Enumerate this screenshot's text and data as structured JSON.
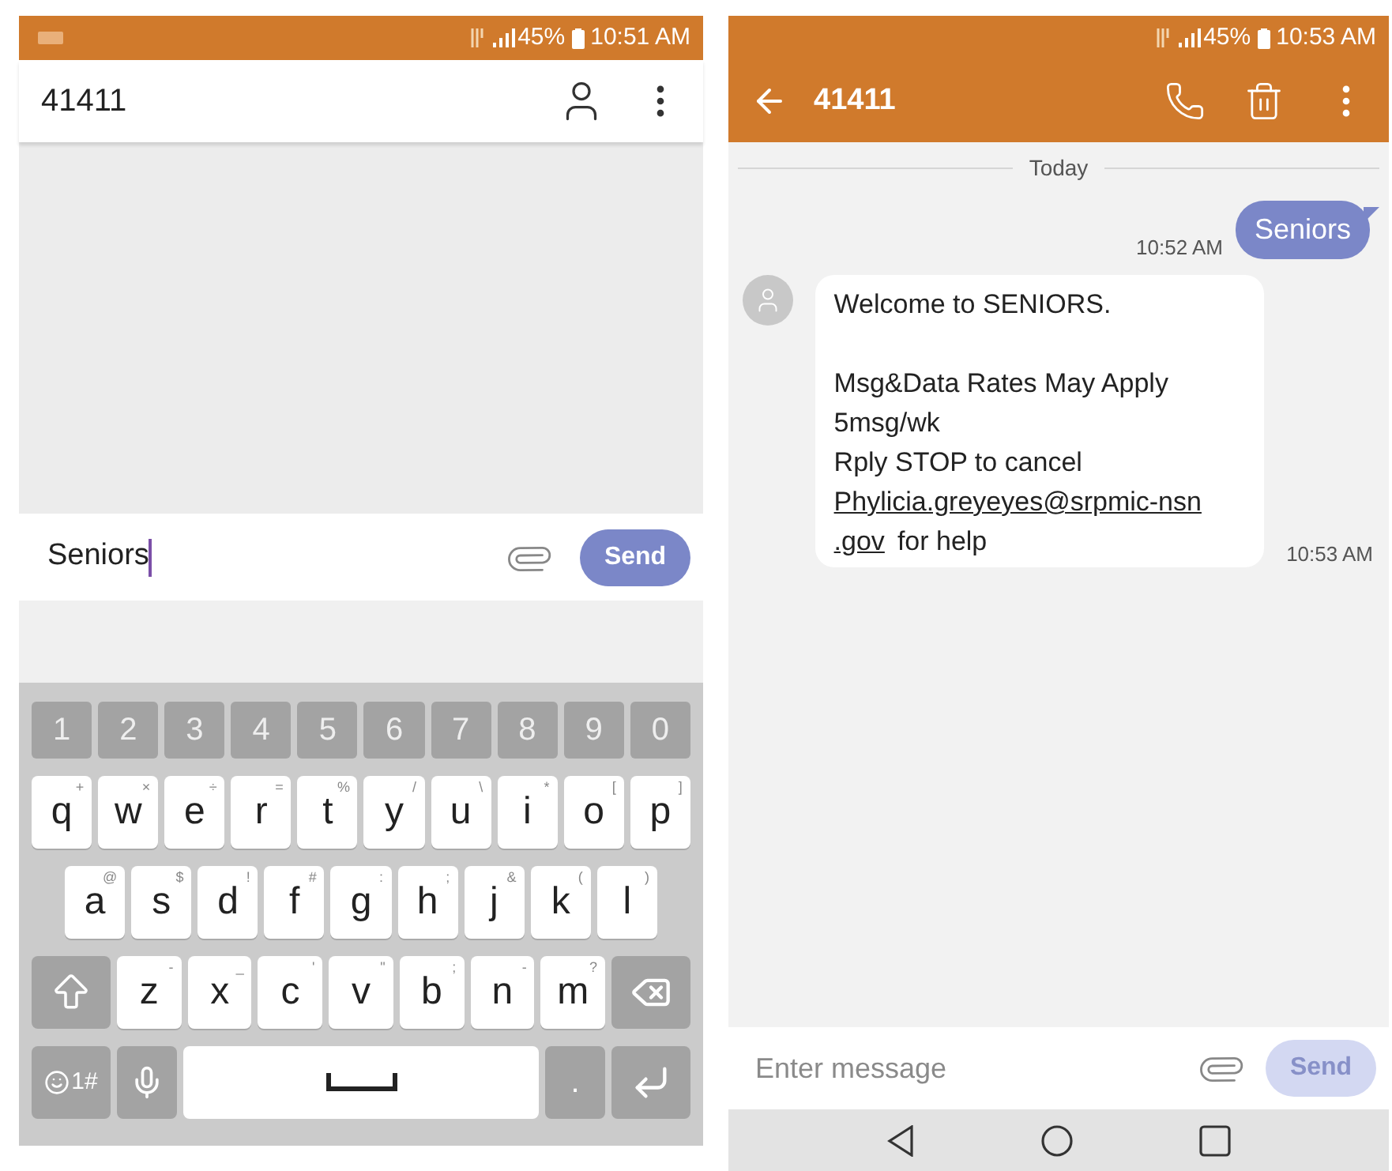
{
  "left_phone": {
    "status_bar": {
      "battery": "45%",
      "time": "10:51 AM"
    },
    "header": {
      "title": "41411"
    },
    "composer": {
      "value": "Seniors",
      "focused": true,
      "send_label": "Send",
      "send_disabled": false
    },
    "keyboard": {
      "number_row": [
        "1",
        "2",
        "3",
        "4",
        "5",
        "6",
        "7",
        "8",
        "9",
        "0"
      ],
      "letter_rows": [
        [
          {
            "key": "q",
            "hint": "+"
          },
          {
            "key": "w",
            "hint": "×"
          },
          {
            "key": "e",
            "hint": "÷"
          },
          {
            "key": "r",
            "hint": "="
          },
          {
            "key": "t",
            "hint": "%"
          },
          {
            "key": "y",
            "hint": "/"
          },
          {
            "key": "u",
            "hint": "\\"
          },
          {
            "key": "i",
            "hint": "*"
          },
          {
            "key": "o",
            "hint": "["
          },
          {
            "key": "p",
            "hint": "]"
          }
        ],
        [
          {
            "key": "a",
            "hint": "@"
          },
          {
            "key": "s",
            "hint": "$"
          },
          {
            "key": "d",
            "hint": "!"
          },
          {
            "key": "f",
            "hint": "#"
          },
          {
            "key": "g",
            "hint": ":"
          },
          {
            "key": "h",
            "hint": ";"
          },
          {
            "key": "j",
            "hint": "&"
          },
          {
            "key": "k",
            "hint": "("
          },
          {
            "key": "l",
            "hint": ")"
          }
        ],
        [
          {
            "key": "z",
            "hint": "-"
          },
          {
            "key": "x",
            "hint": "_"
          },
          {
            "key": "c",
            "hint": "'"
          },
          {
            "key": "v",
            "hint": "\""
          },
          {
            "key": "b",
            "hint": ";"
          },
          {
            "key": "n",
            "hint": "-"
          },
          {
            "key": "m",
            "hint": "?"
          }
        ]
      ],
      "symbols_key": "1#",
      "period_key": "."
    }
  },
  "right_phone": {
    "status_bar": {
      "battery": "45%",
      "time": "10:53 AM"
    },
    "header": {
      "title": "41411"
    },
    "date_divider": "Today",
    "messages": [
      {
        "kind": "sent",
        "text": "Seniors",
        "time": "10:52 AM"
      },
      {
        "kind": "received",
        "title": "Welcome to SENIORS.",
        "lines": [
          "Msg&Data Rates May Apply",
          "5msg/wk",
          "Rply STOP to cancel"
        ],
        "link_lines": [
          "Phylicia.greyeyes@srpmic-nsn",
          ".gov"
        ],
        "tail": "for help",
        "time": "10:53 AM"
      }
    ],
    "composer": {
      "placeholder": "Enter message",
      "focused": false,
      "send_label": "Send",
      "send_disabled": true
    }
  }
}
